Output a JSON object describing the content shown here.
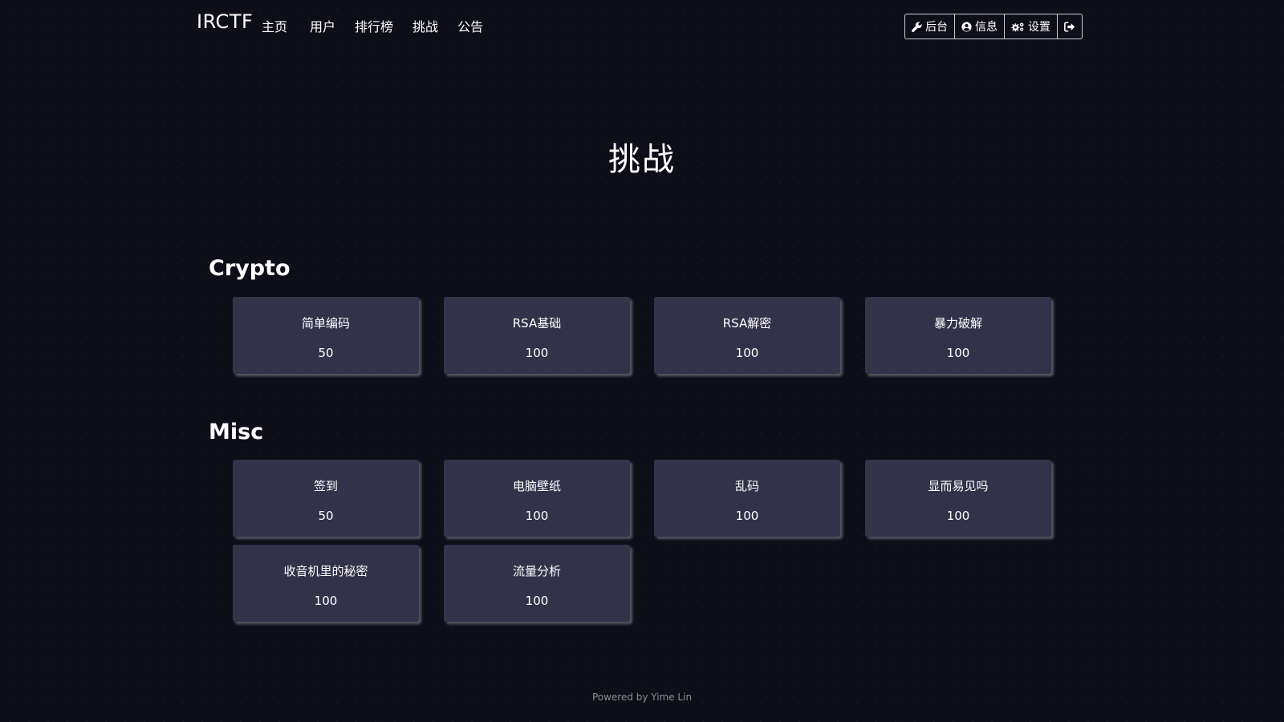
{
  "navbar": {
    "brand": "IRCTF",
    "links": [
      "主页",
      "用户",
      "排行榜",
      "挑战",
      "公告"
    ],
    "buttons": {
      "admin": "后台",
      "info": "信息",
      "settings": "设置"
    }
  },
  "page": {
    "title": "挑战"
  },
  "categories": [
    {
      "name": "Crypto",
      "challenges": [
        {
          "name": "简单编码",
          "points": "50"
        },
        {
          "name": "RSA基础",
          "points": "100"
        },
        {
          "name": "RSA解密",
          "points": "100"
        },
        {
          "name": "暴力破解",
          "points": "100"
        }
      ]
    },
    {
      "name": "Misc",
      "challenges": [
        {
          "name": "签到",
          "points": "50"
        },
        {
          "name": "电脑壁纸",
          "points": "100"
        },
        {
          "name": "乱码",
          "points": "100"
        },
        {
          "name": "显而易见吗",
          "points": "100"
        },
        {
          "name": "收音机里的秘密",
          "points": "100"
        },
        {
          "name": "流量分析",
          "points": "100"
        }
      ]
    }
  ],
  "footer": {
    "text": "Powered by Yime Lin"
  },
  "colors": {
    "background": "#0e0e19",
    "card": "#33324b",
    "text": "#ffffff",
    "footer": "#8d8d98"
  },
  "icons": {
    "admin": "wrench-icon",
    "info": "user-circle-icon",
    "settings": "gears-icon",
    "logout": "sign-out-icon"
  }
}
